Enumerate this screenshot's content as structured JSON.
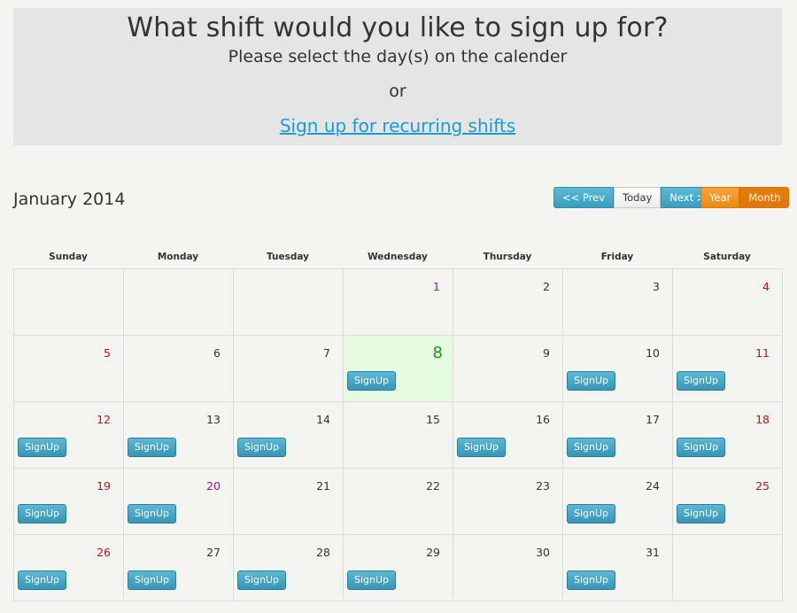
{
  "hero": {
    "title": "What shift would you like to sign up for?",
    "subtitle": "Please select the day(s) on the calender",
    "or_text": "or",
    "recurring_link": "Sign up for recurring shifts"
  },
  "calendar": {
    "month_title": "January 2014",
    "nav": {
      "prev": "<< Prev",
      "today": "Today",
      "next": "Next >>"
    },
    "views": {
      "year": "Year",
      "month": "Month",
      "active": "Month"
    },
    "weekdays": [
      "Sunday",
      "Monday",
      "Tuesday",
      "Wednesday",
      "Thursday",
      "Friday",
      "Saturday"
    ],
    "signup_label": "SignUp",
    "weeks": [
      [
        {
          "day": "",
          "signup": false
        },
        {
          "day": "",
          "signup": false
        },
        {
          "day": "",
          "signup": false
        },
        {
          "day": "1",
          "signup": false,
          "style": "holiday"
        },
        {
          "day": "2",
          "signup": false
        },
        {
          "day": "3",
          "signup": false
        },
        {
          "day": "4",
          "signup": false,
          "style": "weekend"
        }
      ],
      [
        {
          "day": "5",
          "signup": false,
          "style": "weekend"
        },
        {
          "day": "6",
          "signup": false
        },
        {
          "day": "7",
          "signup": false
        },
        {
          "day": "8",
          "signup": true,
          "style": "today"
        },
        {
          "day": "9",
          "signup": false
        },
        {
          "day": "10",
          "signup": true
        },
        {
          "day": "11",
          "signup": true,
          "style": "weekend"
        }
      ],
      [
        {
          "day": "12",
          "signup": true,
          "style": "weekend"
        },
        {
          "day": "13",
          "signup": true
        },
        {
          "day": "14",
          "signup": true
        },
        {
          "day": "15",
          "signup": false
        },
        {
          "day": "16",
          "signup": true
        },
        {
          "day": "17",
          "signup": true
        },
        {
          "day": "18",
          "signup": true,
          "style": "weekend"
        }
      ],
      [
        {
          "day": "19",
          "signup": true,
          "style": "weekend"
        },
        {
          "day": "20",
          "signup": true,
          "style": "holiday"
        },
        {
          "day": "21",
          "signup": false
        },
        {
          "day": "22",
          "signup": false
        },
        {
          "day": "23",
          "signup": false
        },
        {
          "day": "24",
          "signup": true
        },
        {
          "day": "25",
          "signup": true,
          "style": "weekend"
        }
      ],
      [
        {
          "day": "26",
          "signup": true,
          "style": "weekend"
        },
        {
          "day": "27",
          "signup": true
        },
        {
          "day": "28",
          "signup": true
        },
        {
          "day": "29",
          "signup": true
        },
        {
          "day": "30",
          "signup": false
        },
        {
          "day": "31",
          "signup": true
        },
        {
          "day": "",
          "signup": false
        }
      ]
    ]
  },
  "colors": {
    "weekend": "#b3161c",
    "holiday": "#8e1a8e",
    "today_bg": "#e5fbdf",
    "today_num": "#2b8a1f",
    "accent_blue": "#3a9ec0",
    "accent_orange": "#ee8a10",
    "link": "#1a9bd7"
  }
}
